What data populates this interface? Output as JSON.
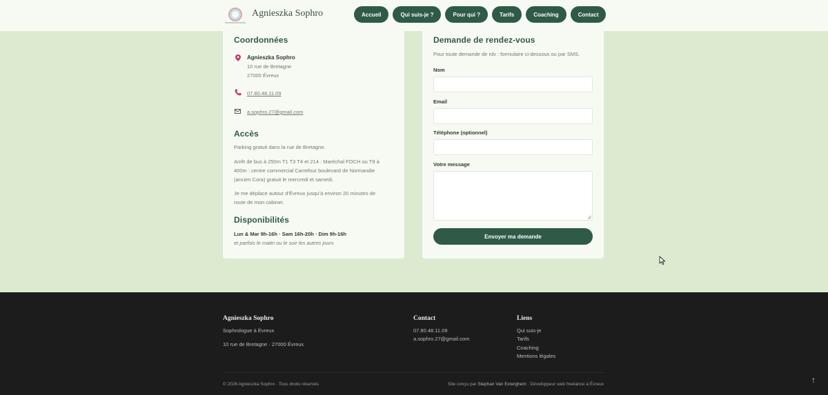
{
  "header": {
    "brand": "Agnieszka Sophro",
    "nav": [
      "Accueil",
      "Qui suis-je ?",
      "Pour qui ?",
      "Tarifs",
      "Coaching",
      "Contact"
    ]
  },
  "coords": {
    "title": "Coordonnées",
    "name": "Agnieszka Sophro",
    "street": "10 rue de Bretagne",
    "city": "27000 Évreux",
    "phone": "07.80.48.11.09",
    "email": "a.sophro.27@gmail.com"
  },
  "access": {
    "title": "Accès",
    "p1": "Parking gratuit dans la rue de Bretagne.",
    "p2a": "Arrêt de bus à 250m T1 T3 T4 et 214 : Maréchal FOCH ou T9 à",
    "p2b": "400m : centre commercial Carrefour boulevard de Normandie",
    "p2c": "(ancien Cora) gratuit le mercredi et samedi.",
    "p3a": "Je me déplace autour d’Évreux jusqu’à environ 20 minutes de",
    "p3b": "route de mon cabinet."
  },
  "dispo": {
    "title": "Disponibilités",
    "hours": "Lun & Mar 9h-16h · Sam 16h-20h · Dim 9h-16h",
    "note": "et parfois le matin ou le soir les autres jours"
  },
  "form": {
    "title": "Demande de rendez-vous",
    "intro": "Pour toute demande de rdv : formulaire ci-dessous ou par SMS.",
    "name_label": "Nom",
    "email_label": "Email",
    "phone_label": "Téléphone (optionnel)",
    "message_label": "Votre message",
    "submit": "Envoyer ma demande"
  },
  "footer": {
    "brand": "Agnieszka Sophro",
    "tagline": "Sophrologue à Évreux",
    "address": "10 rue de Bretagne · 27000 Évreux",
    "contact_title": "Contact",
    "phone": "07.80.48.11.09",
    "email": "a.sophro.27@gmail.com",
    "links_title": "Liens",
    "links": [
      "Qui suis-je",
      "Tarifs",
      "Coaching",
      "Mentions légales"
    ],
    "copyright": "© 2026 Agnieszka Sophro · Tous droits réservés",
    "credit_prefix": "Site conçu par ",
    "credit_name": "Stephan Van Exterghem",
    "credit_suffix": " · Développeur web freelance à Évreux",
    "to_top": "↑"
  },
  "colors": {
    "accent": "#2f5a48",
    "background": "#dcebd0",
    "card": "#f7faf3",
    "footer": "#1c1c1c",
    "icon": "#c8386e"
  }
}
